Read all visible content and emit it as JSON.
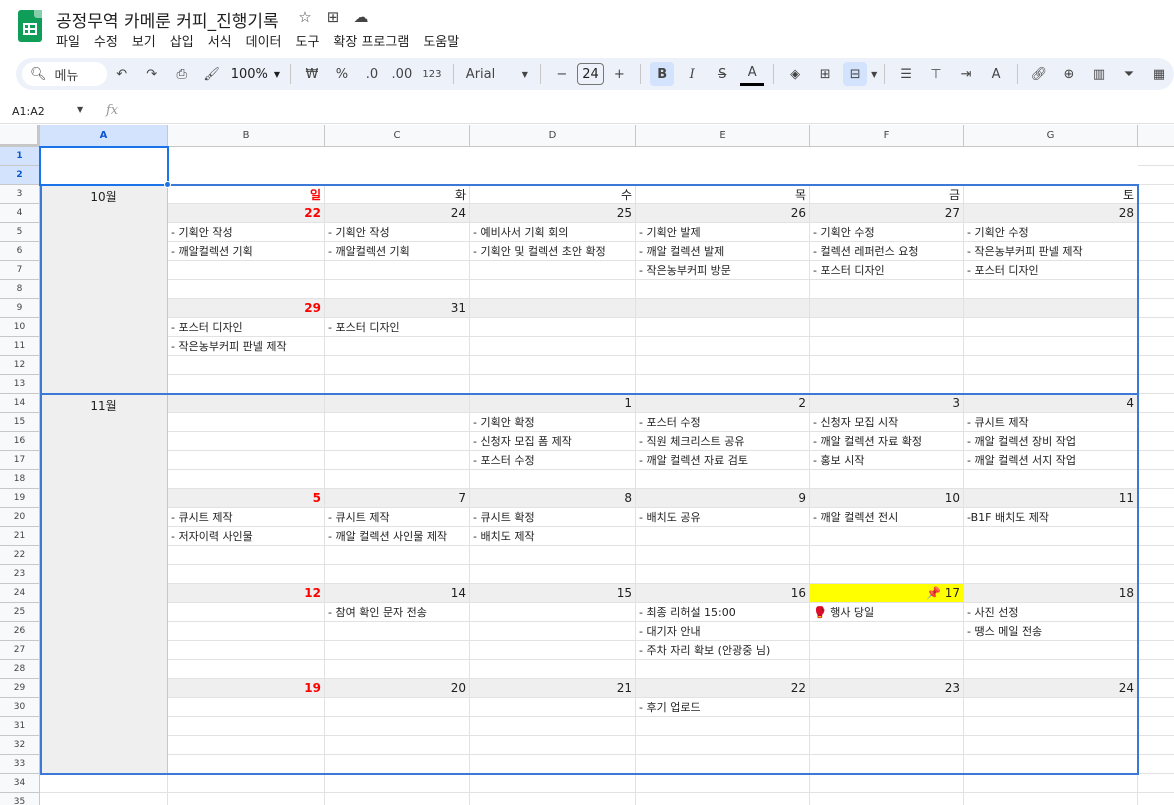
{
  "title": "공정무역 카메룬 커피_진행기록",
  "title_icons": [
    "star-icon",
    "move-folder-icon",
    "cloud-status-icon"
  ],
  "menu": [
    "파일",
    "수정",
    "보기",
    "삽입",
    "서식",
    "데이터",
    "도구",
    "확장 프로그램",
    "도움말"
  ],
  "toolbar": {
    "search_label": "메뉴",
    "zoom": "100%",
    "currency": "₩",
    "percent": "%",
    "dec_decrease": ".0",
    "dec_increase": ".00",
    "number_format": "123",
    "font": "Arial",
    "font_size": "24"
  },
  "formula": {
    "name_box": "A1:A2",
    "fx": "fx"
  },
  "columns": [
    "A",
    "B",
    "C",
    "D",
    "E",
    "F",
    "G"
  ],
  "weekdays": [
    "일",
    "화",
    "수",
    "목",
    "금",
    "토"
  ],
  "months": {
    "oct": "10월",
    "nov": "11월"
  },
  "calendar": {
    "oct_w1_dates": [
      "22",
      "24",
      "25",
      "26",
      "27",
      "28"
    ],
    "oct_w1_events": [
      [
        "- 기획안 작성",
        "- 기획안 작성",
        "- 예비사서 기획 회의",
        "- 기획안 발제",
        "- 기획안 수정",
        "- 기획안 수정"
      ],
      [
        "- 깨알컬렉션 기획",
        "- 깨알컬렉션 기획",
        "- 기획안 및 컬렉션 초안 확정",
        "- 깨알 컬렉션 발제",
        "- 컬렉션 레퍼런스 요청",
        "- 작은농부커피 판넬 제작"
      ],
      [
        "",
        "",
        "",
        "- 작은농부커피 방문",
        "- 포스터 디자인",
        "- 포스터 디자인"
      ]
    ],
    "oct_w2_dates": [
      "29",
      "31",
      "",
      "",
      "",
      ""
    ],
    "oct_w2_events": [
      [
        "- 포스터 디자인",
        "- 포스터 디자인",
        "",
        "",
        "",
        ""
      ],
      [
        "- 작은농부커피 판넬 제작",
        "",
        "",
        "",
        "",
        ""
      ]
    ],
    "nov_w1_dates": [
      "",
      "",
      "1",
      "2",
      "3",
      "4"
    ],
    "nov_w1_events": [
      [
        "",
        "",
        "- 기획안 확정",
        "- 포스터 수정",
        "- 신청자 모집 시작",
        "- 큐시트 제작"
      ],
      [
        "",
        "",
        "- 신청자 모집 폼 제작",
        "- 직원 체크리스트 공유",
        "- 깨알 컬렉션 자료 확정",
        "- 깨알 컬렉션 장비 작업"
      ],
      [
        "",
        "",
        "- 포스터 수정",
        "- 깨알 컬렉션 자료 검토",
        "- 홍보 시작",
        "- 깨알 컬렉션 서지 작업"
      ]
    ],
    "nov_w2_dates": [
      "5",
      "7",
      "8",
      "9",
      "10",
      "11"
    ],
    "nov_w2_events": [
      [
        "- 큐시트 제작",
        "- 큐시트 제작",
        "- 큐시트 확정",
        "- 배치도 공유",
        "- 깨알 컬렉션 전시",
        "-B1F 배치도 제작"
      ],
      [
        "- 저자이력 사인물",
        "- 깨알 컬렉션 사인물 제작",
        "- 배치도 제작",
        "",
        "",
        ""
      ]
    ],
    "nov_w3_dates": [
      "12",
      "14",
      "15",
      "16",
      "📌 17",
      "18"
    ],
    "nov_w3_events": [
      [
        "",
        "- 참여 확인 문자 전송",
        "",
        "- 최종 리허설 15:00",
        "🥊 행사 당일",
        "- 사진 선정"
      ],
      [
        "",
        "",
        "",
        "- 대기자 안내",
        "",
        "- 땡스 메일 전송"
      ],
      [
        "",
        "",
        "",
        "- 주차 자리 확보 (안광중 님)",
        "",
        ""
      ]
    ],
    "nov_w4_dates": [
      "19",
      "20",
      "21",
      "22",
      "23",
      "24"
    ],
    "nov_w4_events": [
      [
        "",
        "",
        "",
        "- 후기 업로드",
        "",
        ""
      ]
    ]
  },
  "colors": {
    "sunday": "#ff0000",
    "highlight": "#ffff00",
    "date_row_bg": "#efefef",
    "block_border": "#3c78d8"
  }
}
